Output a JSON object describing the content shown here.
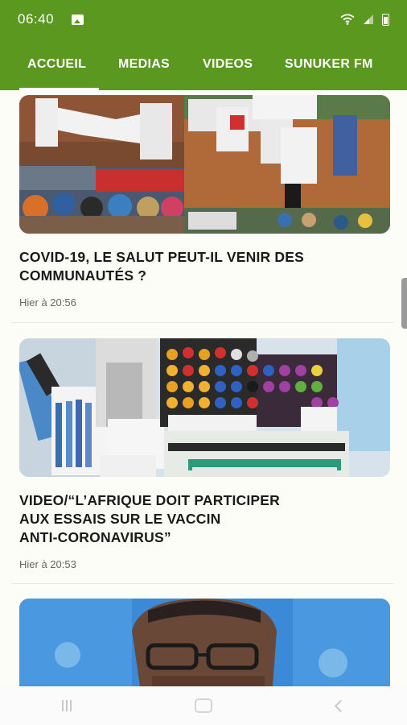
{
  "status_bar": {
    "time": "06:40"
  },
  "tabs": [
    {
      "label": "ACCUEIL"
    },
    {
      "label": "MEDIAS"
    },
    {
      "label": "VIDEOS"
    },
    {
      "label": "SUNUKER FM"
    }
  ],
  "articles": [
    {
      "title_lines": [
        "COVID-19, LE SALUT PEUT-IL VENIR DES",
        "COMMUNAUTÉS ?"
      ],
      "time": "Hier à 20:56"
    },
    {
      "title_lines": [
        "VIDEO/“L’AFRIQUE DOIT PARTICIPER",
        "AUX ESSAIS SUR LE VACCIN",
        "ANTI-CORONAVIRUS”"
      ],
      "time": "Hier à 20:53"
    }
  ],
  "colors": {
    "brand_green": "#5a9820",
    "background": "#fdfdf8"
  },
  "icons": [
    "image-notification-icon",
    "wifi-icon",
    "signal-icon",
    "battery-icon",
    "recent-apps-icon",
    "home-icon",
    "back-icon"
  ]
}
